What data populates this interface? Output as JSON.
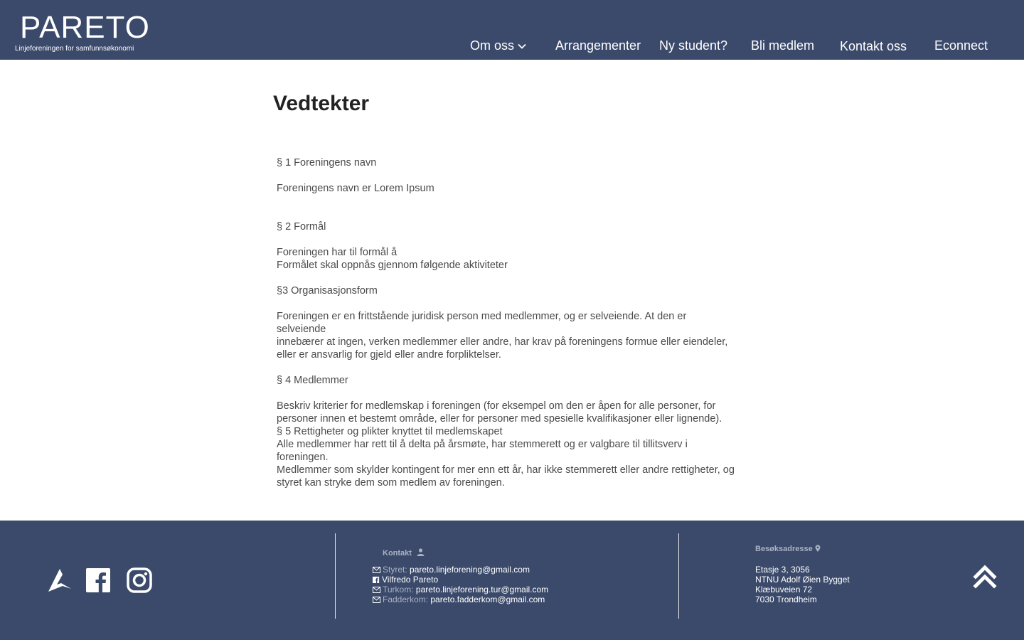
{
  "header": {
    "logo_text": "PARETO",
    "logo_subtitle": "Linjeforeningen for samfunnsøkonomi",
    "nav": [
      {
        "label": "Om oss",
        "has_dropdown": true
      },
      {
        "label": "Arrangementer"
      },
      {
        "label": "Ny student?"
      },
      {
        "label": "Bli medlem"
      },
      {
        "label": "Kontakt oss"
      },
      {
        "label": "Econnect"
      }
    ]
  },
  "main": {
    "title": "Vedtekter",
    "sections": {
      "s1_heading": "§ 1 Foreningens navn",
      "s1_text": "Foreningens navn er  Lorem Ipsum",
      "s2_heading": "§ 2 Formål",
      "s2_line1": "Foreningen har til formål å",
      "s2_line2": "Formålet skal oppnås gjennom følgende aktiviteter",
      "s3_heading": "§3 Organisasjonsform",
      "s3_line1": "Foreningen er en frittstående juridisk person med medlemmer, og er selveiende. At den er selveiende",
      "s3_line2": "innebærer at ingen, verken medlemmer eller andre, har krav på foreningens formue eller eiendeler, eller er ansvarlig for gjeld eller andre forpliktelser.",
      "s4_heading": "§ 4 Medlemmer",
      "s4_text": "Beskriv kriterier for medlemskap i foreningen (for eksempel om den er åpen for alle personer, for personer innen et bestemt område, eller for personer med spesielle kvalifikasjoner eller lignende).",
      "s5_heading": "§ 5 Rettigheter og plikter knyttet til medlemskapet",
      "s5_line1": "Alle medlemmer har rett til å delta på årsmøte, har stemmerett og er valgbare til tillitsverv i foreningen.",
      "s5_line2": "Medlemmer som skylder kontingent for mer enn ett år, har ikke stemmerett eller andre rettigheter, og",
      "s5_line3": "styret kan stryke dem som medlem av foreningen."
    }
  },
  "footer": {
    "contact_heading": "Kontakt",
    "contacts": [
      {
        "label": "Styret:",
        "value": "pareto.linjeforening@gmail.com",
        "icon": "mail-icon"
      },
      {
        "label": "",
        "value": "Vilfredo Pareto",
        "icon": "facebook-icon"
      },
      {
        "label": "Turkom:",
        "value": "pareto.linjeforening.tur@gmail.com",
        "icon": "mail-icon"
      },
      {
        "label": "Fadderkom:",
        "value": "pareto.fadderkom@gmail.com",
        "icon": "mail-icon"
      }
    ],
    "address_heading": "Besøksadresse",
    "address": [
      "Etasje 3, 3056",
      "NTNU Adolf Øien Bygget",
      "Klæbuveien 72",
      "7030 Trondheim"
    ],
    "colors": {
      "background": "#3b4a6b",
      "muted": "#a9b1c3"
    }
  }
}
